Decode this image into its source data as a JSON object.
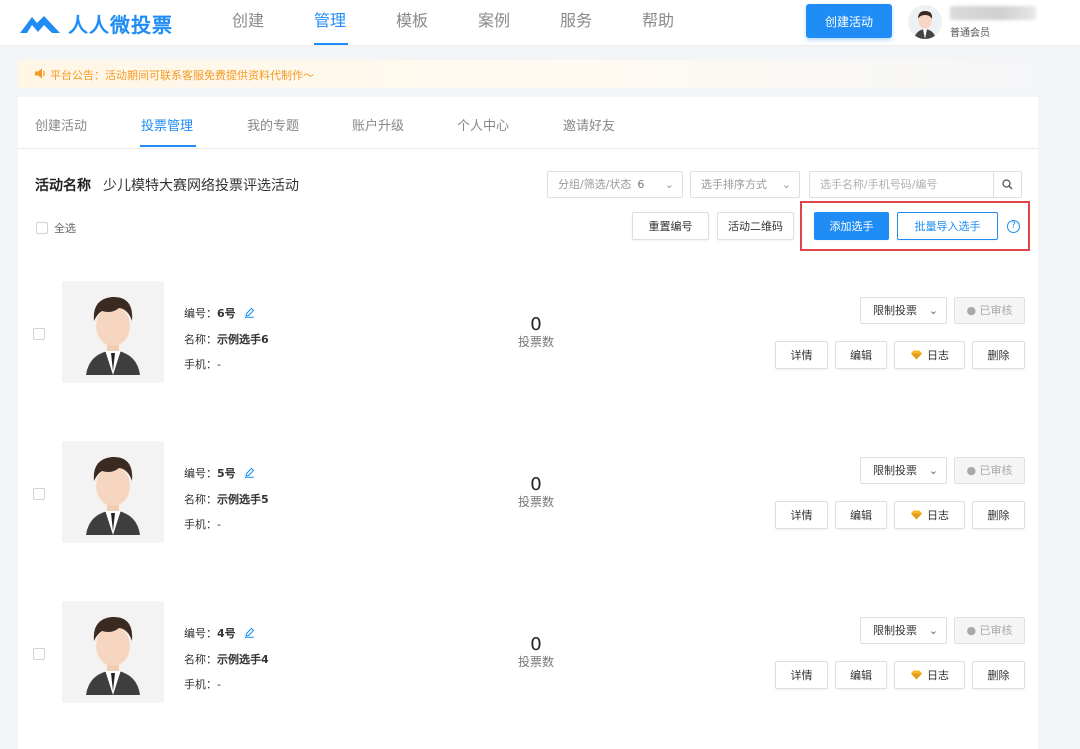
{
  "app": {
    "logo_text": "人人微投票"
  },
  "nav": {
    "items": [
      "创建",
      "管理",
      "模板",
      "案例",
      "服务",
      "帮助"
    ],
    "active": "管理"
  },
  "header": {
    "create_button": "创建活动",
    "user_level": "普通会员"
  },
  "notice": {
    "text": "平台公告：活动期间可联系客服免费提供资料代制作～"
  },
  "subtabs": {
    "items": [
      "创建活动",
      "投票管理",
      "我的专题",
      "账户升级",
      "个人中心",
      "邀请好友"
    ],
    "active": "投票管理"
  },
  "activity": {
    "title_label": "活动名称",
    "name": "少儿模特大赛网络投票评选活动"
  },
  "filters": {
    "group_label": "分组/筛选/状态",
    "group_count": "6",
    "sort_label": "选手排序方式",
    "search_placeholder": "选手名称/手机号码/编号"
  },
  "toolbar": {
    "select_all": "全选",
    "renumber": "重置编号",
    "qrcode": "活动二维码",
    "add_player": "添加选手",
    "batch_import": "批量导入选手",
    "help": "?"
  },
  "row_labels": {
    "number": "编号：",
    "name": "名称：",
    "phone": "手机：",
    "votes": "投票数",
    "limit": "限制投票",
    "audited": "● 已审核",
    "detail": "详情",
    "edit": "编辑",
    "log": "日志",
    "delete": "删除"
  },
  "players": [
    {
      "number": "6号",
      "name": "示例选手6",
      "phone": "-",
      "votes": "0"
    },
    {
      "number": "5号",
      "name": "示例选手5",
      "phone": "-",
      "votes": "0"
    },
    {
      "number": "4号",
      "name": "示例选手4",
      "phone": "-",
      "votes": "0"
    }
  ],
  "colors": {
    "accent": "#1f8df5",
    "notice": "#f59a23",
    "highlight": "#e0454a"
  }
}
